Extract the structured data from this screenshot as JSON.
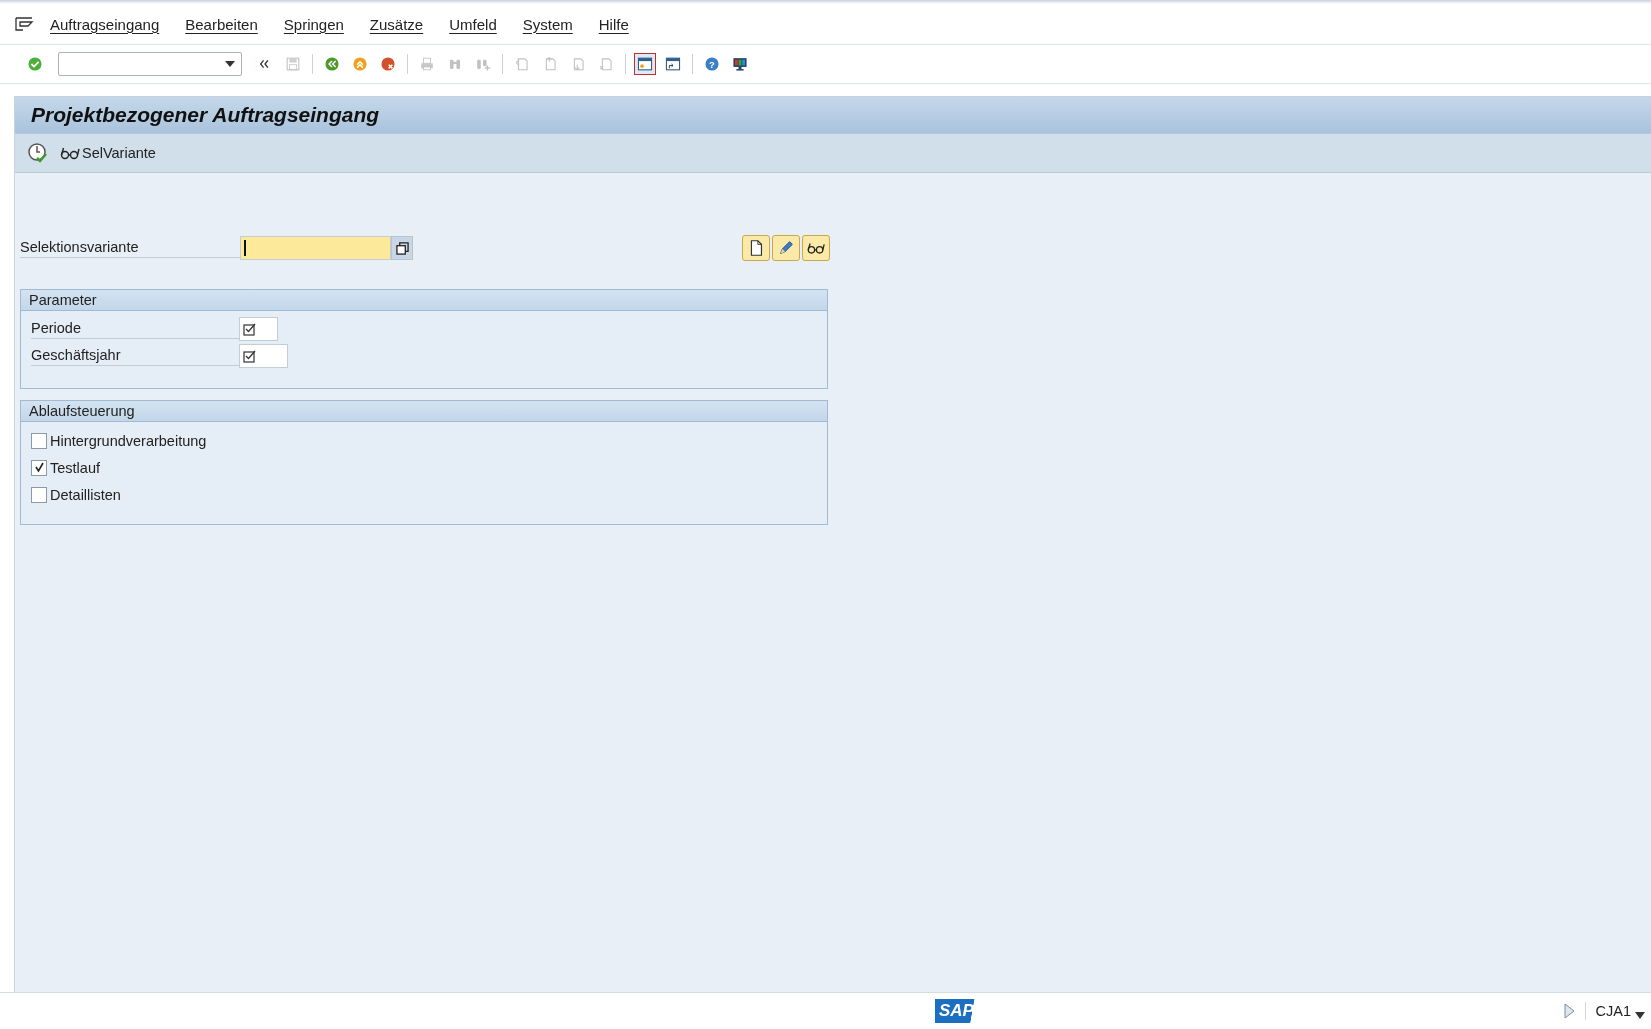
{
  "menu": [
    {
      "label": "Auftragseingang"
    },
    {
      "label": "Bearbeiten"
    },
    {
      "label": "Springen"
    },
    {
      "label": "Zusätze"
    },
    {
      "label": "Umfeld"
    },
    {
      "label": "System"
    },
    {
      "label": "Hilfe"
    }
  ],
  "toolbar": [
    {
      "kind": "enter",
      "disabled": false
    },
    {
      "kind": "command"
    },
    {
      "kind": "collapse",
      "disabled": false
    },
    {
      "kind": "save",
      "disabled": true
    },
    {
      "kind": "sep"
    },
    {
      "kind": "back",
      "disabled": false
    },
    {
      "kind": "exit",
      "disabled": false
    },
    {
      "kind": "cancel",
      "disabled": false
    },
    {
      "kind": "sep"
    },
    {
      "kind": "print",
      "disabled": true
    },
    {
      "kind": "find",
      "disabled": true
    },
    {
      "kind": "findnext",
      "disabled": true
    },
    {
      "kind": "sep"
    },
    {
      "kind": "first",
      "disabled": true
    },
    {
      "kind": "prev",
      "disabled": true
    },
    {
      "kind": "next",
      "disabled": true
    },
    {
      "kind": "last",
      "disabled": true
    },
    {
      "kind": "sep"
    },
    {
      "kind": "newsession",
      "disabled": false,
      "selected": true
    },
    {
      "kind": "shortcut",
      "disabled": false,
      "selected": false
    },
    {
      "kind": "sep"
    },
    {
      "kind": "help",
      "disabled": false,
      "label": "?"
    },
    {
      "kind": "layout",
      "disabled": false
    }
  ],
  "title": "Projektbezogener Auftragseingang",
  "app_toolbar": [
    {
      "kind": "execute"
    },
    {
      "kind": "variant",
      "label": "SelVariante"
    }
  ],
  "variant_field": {
    "label": "Selektionsvariante",
    "focused": true
  },
  "variant_buttons": [
    {
      "kind": "new"
    },
    {
      "kind": "edit"
    },
    {
      "kind": "variant"
    }
  ],
  "groups": [
    {
      "title": "Parameter",
      "kind": "fields",
      "items": [
        {
          "label": "Periode",
          "required": true
        },
        {
          "label": "Geschäftsjahr",
          "required": true
        }
      ]
    },
    {
      "title": "Ablaufsteuerung",
      "kind": "checks",
      "items": [
        {
          "label": "Hintergrundverarbeitung",
          "checked": false
        },
        {
          "label": "Testlauf",
          "checked": true
        },
        {
          "label": "Detaillisten",
          "checked": false
        }
      ]
    }
  ],
  "status_bar": {
    "logo": "SAP",
    "transaction": "CJA1"
  }
}
